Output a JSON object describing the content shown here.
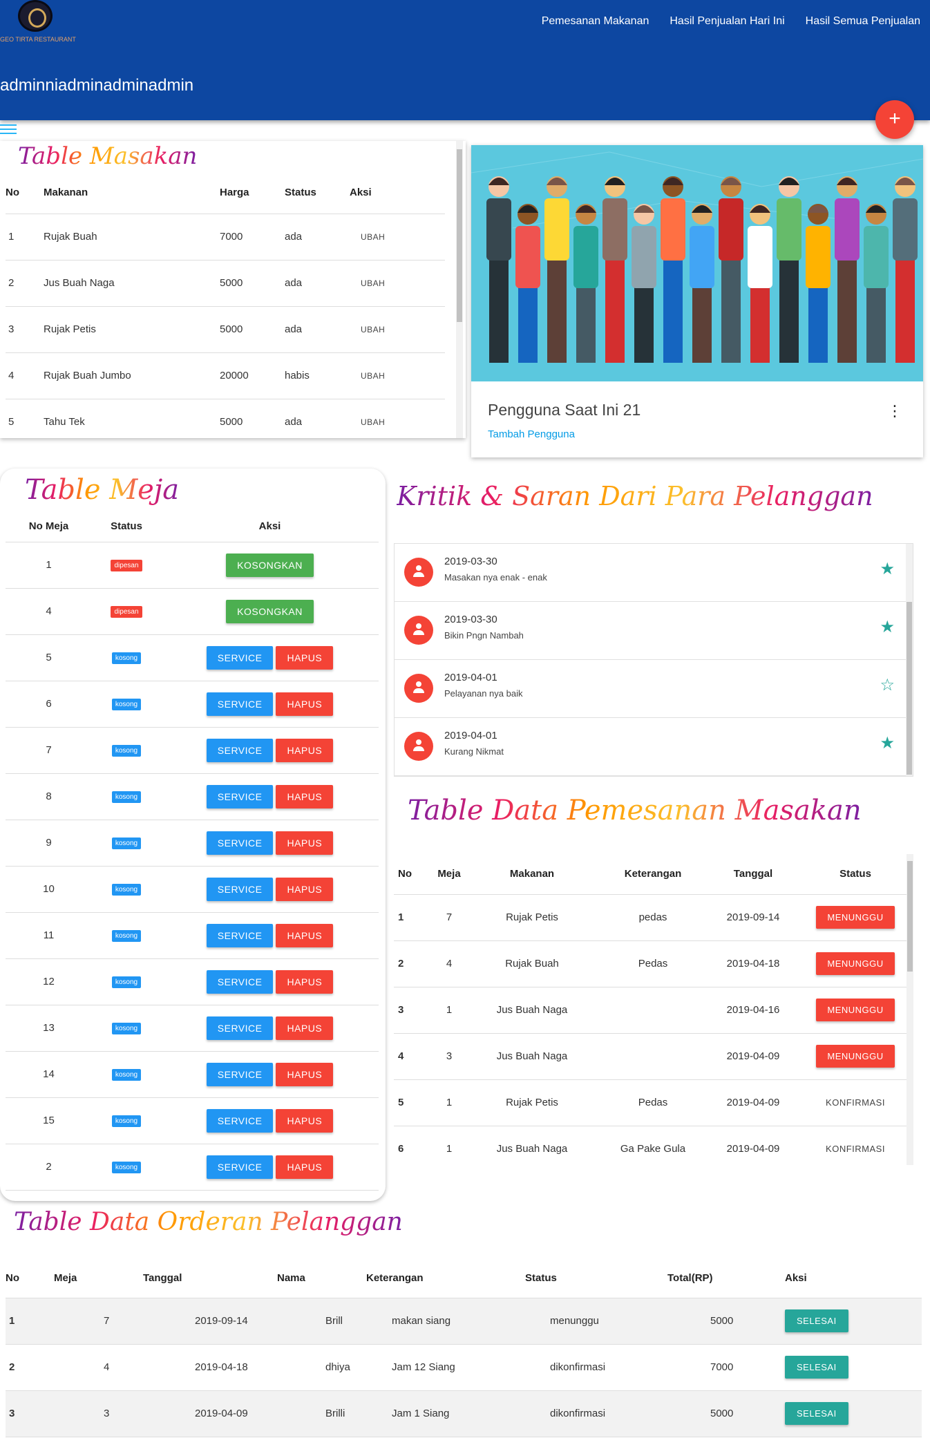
{
  "brand": {
    "logo_text": "GEO TIRTA RESTAURANT"
  },
  "nav": [
    "Pemesanan Makanan",
    "Hasil Penjualan Hari Ini",
    "Hasil Semua Penjualan"
  ],
  "page_title": "adminniadminadminadmin",
  "fab_label": "+",
  "masakan": {
    "title": "Table Masakan",
    "headers": [
      "No",
      "Makanan",
      "Harga",
      "Status",
      "Aksi"
    ],
    "rows": [
      {
        "no": "1",
        "makanan": "Rujak Buah",
        "harga": "7000",
        "status": "ada",
        "aksi": "UBAH"
      },
      {
        "no": "2",
        "makanan": "Jus Buah Naga",
        "harga": "5000",
        "status": "ada",
        "aksi": "UBAH"
      },
      {
        "no": "3",
        "makanan": "Rujak Petis",
        "harga": "5000",
        "status": "ada",
        "aksi": "UBAH"
      },
      {
        "no": "4",
        "makanan": "Rujak Buah Jumbo",
        "harga": "20000",
        "status": "habis",
        "aksi": "UBAH"
      },
      {
        "no": "5",
        "makanan": "Tahu Tek",
        "harga": "5000",
        "status": "ada",
        "aksi": "UBAH"
      }
    ]
  },
  "pengguna": {
    "count_text": "Pengguna Saat Ini 21",
    "add_link": "Tambah Pengguna",
    "more_icon": "more-vert-icon"
  },
  "meja": {
    "title": "Table Meja",
    "headers": [
      "No Meja",
      "Status",
      "Aksi"
    ],
    "rows": [
      {
        "no": "1",
        "status": "dipesan",
        "actions": [
          "KOSONGKAN"
        ]
      },
      {
        "no": "4",
        "status": "dipesan",
        "actions": [
          "KOSONGKAN"
        ]
      },
      {
        "no": "5",
        "status": "kosong",
        "actions": [
          "SERVICE",
          "HAPUS"
        ]
      },
      {
        "no": "6",
        "status": "kosong",
        "actions": [
          "SERVICE",
          "HAPUS"
        ]
      },
      {
        "no": "7",
        "status": "kosong",
        "actions": [
          "SERVICE",
          "HAPUS"
        ]
      },
      {
        "no": "8",
        "status": "kosong",
        "actions": [
          "SERVICE",
          "HAPUS"
        ]
      },
      {
        "no": "9",
        "status": "kosong",
        "actions": [
          "SERVICE",
          "HAPUS"
        ]
      },
      {
        "no": "10",
        "status": "kosong",
        "actions": [
          "SERVICE",
          "HAPUS"
        ]
      },
      {
        "no": "11",
        "status": "kosong",
        "actions": [
          "SERVICE",
          "HAPUS"
        ]
      },
      {
        "no": "12",
        "status": "kosong",
        "actions": [
          "SERVICE",
          "HAPUS"
        ]
      },
      {
        "no": "13",
        "status": "kosong",
        "actions": [
          "SERVICE",
          "HAPUS"
        ]
      },
      {
        "no": "14",
        "status": "kosong",
        "actions": [
          "SERVICE",
          "HAPUS"
        ]
      },
      {
        "no": "15",
        "status": "kosong",
        "actions": [
          "SERVICE",
          "HAPUS"
        ]
      },
      {
        "no": "2",
        "status": "kosong",
        "actions": [
          "SERVICE",
          "HAPUS"
        ]
      }
    ]
  },
  "kritik": {
    "title": "Kritik & Saran Dari Para Pelanggan",
    "items": [
      {
        "date": "2019-03-30",
        "message": "Masakan nya enak - enak",
        "starred": true
      },
      {
        "date": "2019-03-30",
        "message": "Bikin Pngn Nambah",
        "starred": true
      },
      {
        "date": "2019-04-01",
        "message": "Pelayanan nya baik",
        "starred": false
      },
      {
        "date": "2019-04-01",
        "message": "Kurang Nikmat",
        "starred": true
      }
    ]
  },
  "pemesanan": {
    "title": "Table Data Pemesanan Masakan",
    "headers": [
      "No",
      "Meja",
      "Makanan",
      "Keterangan",
      "Tanggal",
      "Status"
    ],
    "rows": [
      {
        "no": "1",
        "meja": "7",
        "makanan": "Rujak Petis",
        "keterangan": "pedas",
        "tanggal": "2019-09-14",
        "status": "MENUNGGU"
      },
      {
        "no": "2",
        "meja": "4",
        "makanan": "Rujak Buah",
        "keterangan": "Pedas",
        "tanggal": "2019-04-18",
        "status": "MENUNGGU"
      },
      {
        "no": "3",
        "meja": "1",
        "makanan": "Jus Buah Naga",
        "keterangan": "",
        "tanggal": "2019-04-16",
        "status": "MENUNGGU"
      },
      {
        "no": "4",
        "meja": "3",
        "makanan": "Jus Buah Naga",
        "keterangan": "",
        "tanggal": "2019-04-09",
        "status": "MENUNGGU"
      },
      {
        "no": "5",
        "meja": "1",
        "makanan": "Rujak Petis",
        "keterangan": "Pedas",
        "tanggal": "2019-04-09",
        "status": "KONFIRMASI"
      },
      {
        "no": "6",
        "meja": "1",
        "makanan": "Jus Buah Naga",
        "keterangan": "Ga Pake Gula",
        "tanggal": "2019-04-09",
        "status": "KONFIRMASI"
      }
    ]
  },
  "order": {
    "title": "Table Data Orderan Pelanggan",
    "headers": [
      "No",
      "Meja",
      "Tanggal",
      "Nama",
      "Keterangan",
      "Status",
      "Total(RP)",
      "Aksi"
    ],
    "rows": [
      {
        "no": "1",
        "meja": "7",
        "tanggal": "2019-09-14",
        "nama": "Brill",
        "keterangan": "makan siang",
        "status": "menunggu",
        "total": "5000",
        "aksi": "SELESAI"
      },
      {
        "no": "2",
        "meja": "4",
        "tanggal": "2019-04-18",
        "nama": "dhiya",
        "keterangan": "Jam 12 Siang",
        "status": "dikonfirmasi",
        "total": "7000",
        "aksi": "SELESAI"
      },
      {
        "no": "3",
        "meja": "3",
        "tanggal": "2019-04-09",
        "nama": "Brilli",
        "keterangan": "Jam 1 Siang",
        "status": "dikonfirmasi",
        "total": "5000",
        "aksi": "SELESAI"
      }
    ]
  },
  "colors": {
    "header": "#0d47a1",
    "danger": "#f44336",
    "primary": "#2196f3",
    "success": "#4caf50",
    "teal": "#26a69a"
  }
}
